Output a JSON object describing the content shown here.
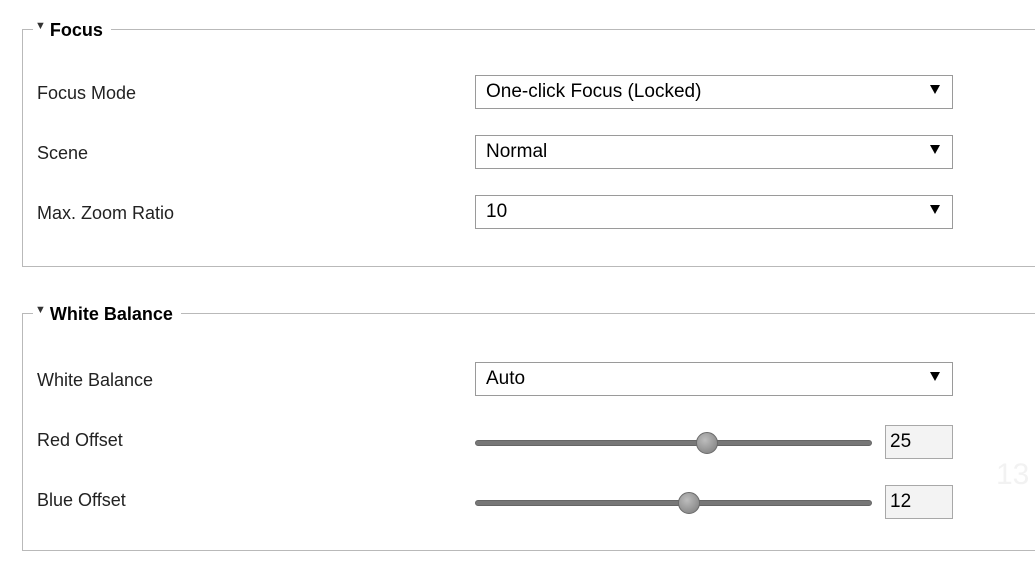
{
  "focus_section": {
    "title": "Focus",
    "focus_mode": {
      "label": "Focus Mode",
      "value": "One-click Focus (Locked)"
    },
    "scene": {
      "label": "Scene",
      "value": "Normal"
    },
    "max_zoom": {
      "label": "Max. Zoom Ratio",
      "value": "10"
    }
  },
  "white_balance_section": {
    "title": "White Balance",
    "white_balance": {
      "label": "White Balance",
      "value": "Auto"
    },
    "red_offset": {
      "label": "Red Offset",
      "value": "25",
      "slider_fraction": 0.59
    },
    "blue_offset": {
      "label": "Blue Offset",
      "value": "12",
      "slider_fraction": 0.54
    }
  },
  "background_text": "13"
}
